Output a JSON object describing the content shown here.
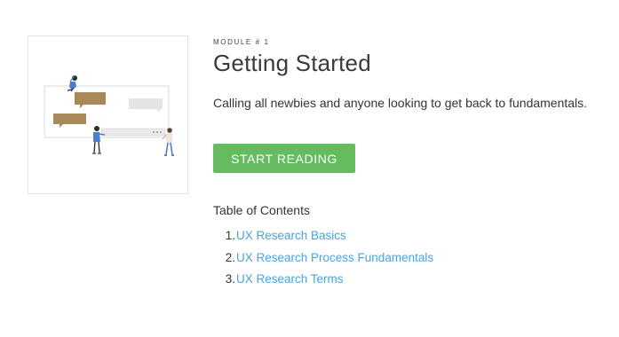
{
  "module": {
    "label": "MODULE # 1",
    "title": "Getting Started",
    "description": "Calling all newbies and anyone looking to get back to fundamentals.",
    "start_button": "START READING"
  },
  "toc": {
    "heading": "Table of Contents",
    "items": [
      {
        "number": "1.",
        "label": "UX Research Basics"
      },
      {
        "number": "2.",
        "label": "UX Research Process Fundamentals"
      },
      {
        "number": "3.",
        "label": "UX Research Terms"
      }
    ]
  },
  "colors": {
    "button": "#65bc5f",
    "link": "#4aa3df",
    "speech_brown": "#a88a5a",
    "speech_gray": "#e4e4e4",
    "figure_blue": "#4a7fd0"
  },
  "illustration": {
    "icon": "people-chatting-illustration"
  }
}
